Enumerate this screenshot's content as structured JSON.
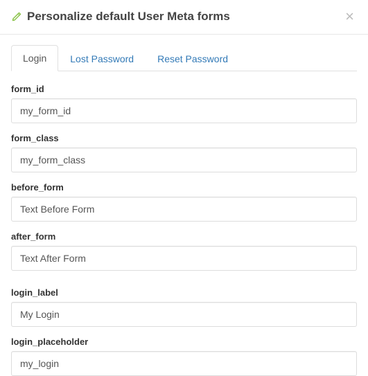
{
  "modal": {
    "title": "Personalize default User Meta forms"
  },
  "tabs": {
    "login": "Login",
    "lost_password": "Lost Password",
    "reset_password": "Reset Password"
  },
  "fields": {
    "form_id": {
      "label": "form_id",
      "value": "my_form_id"
    },
    "form_class": {
      "label": "form_class",
      "value": "my_form_class"
    },
    "before_form": {
      "label": "before_form",
      "value": "Text Before Form"
    },
    "after_form": {
      "label": "after_form",
      "value": "Text After Form"
    },
    "login_label": {
      "label": "login_label",
      "value": "My Login"
    },
    "login_placeholder": {
      "label": "login_placeholder",
      "value": "my_login"
    }
  }
}
